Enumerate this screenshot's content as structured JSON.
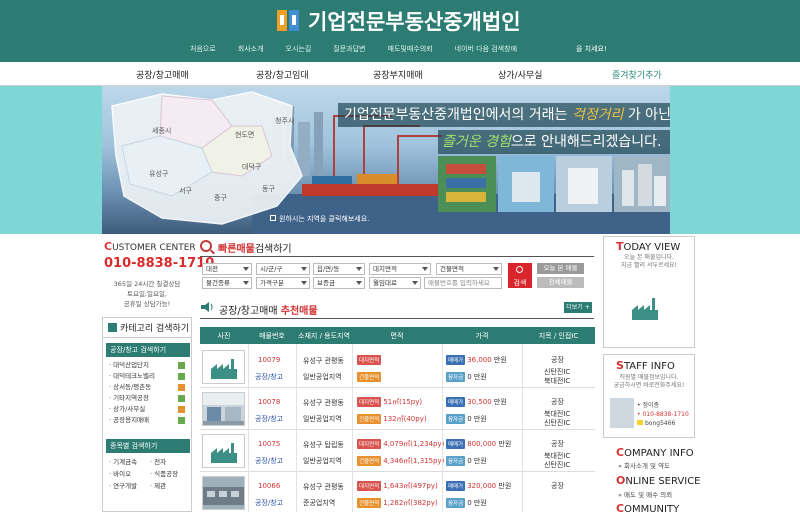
{
  "header": {
    "logo_text": "기업전문부동산중개법인",
    "top_nav": [
      "처음으로",
      "회사소개",
      "오시는길",
      "질문과답변",
      "매도및매수의뢰",
      "네이버 다음 검색창에"
    ],
    "login_text": "을 치세요!",
    "brand_color": "#2c7c73"
  },
  "main_nav": [
    "공장/창고매매",
    "공장/창고임대",
    "공장부지매매",
    "상가/사무실",
    "즐겨찾기추가"
  ],
  "banner": {
    "line1_pre": "기업전문부동산중개법인에서의 거래는 ",
    "line1_hl": "걱정거리",
    "line1_post": " 가 아닌",
    "line2_hl": "즐거운 경험",
    "line2_post": "으로 안내해드리겠습니다.",
    "caption": "원하시는 지역을 클릭해보세요.",
    "regions": [
      "세종시",
      "청주시",
      "현도면",
      "대덕구",
      "유성구",
      "서구",
      "동구",
      "중구"
    ]
  },
  "customer_center": {
    "title_c": "C",
    "title_rest": "USTOMER CENTER",
    "phone": "010-8838-1710",
    "hours": [
      "365일 24시간 칠결상담",
      "토요일,일요일,",
      "공휴일 상담가능!"
    ]
  },
  "category": {
    "title": "카테고리 검색하기",
    "section1": "공장/창고 검색하기",
    "items1": [
      "대덕산업단지",
      "대덕테크노밸리",
      "상서동/평촌동",
      "기타지역공장",
      "상가/사무실",
      "공장용지매매"
    ],
    "section2": "종목별 검색하기",
    "items2": [
      [
        "기계금속",
        "전자"
      ],
      [
        "바이오",
        "식품공장"
      ],
      [
        "연구개발",
        "제관"
      ]
    ]
  },
  "quick_search": {
    "title_red": "빠른매물",
    "title_rest": "검색하기",
    "selects_row1": [
      "대전",
      "시/군/구",
      "읍/면/동",
      "대지면적",
      "건물면적"
    ],
    "selects_row2": [
      "물건종류",
      "가격구분",
      "보증금",
      "월임대료"
    ],
    "input_placeholder": "매물번호를 입력하세요",
    "search_label": "검색",
    "today_btn": "오늘 본 매물",
    "all_btn": "전체매물"
  },
  "recommend": {
    "title_rest": "공장/창고매매 ",
    "title_red": "추천매물",
    "more": "더보기 +"
  },
  "table": {
    "headers": [
      "사진",
      "매물번호",
      "소재지 / 용도지역",
      "면적",
      "가격",
      "지목 / 인접IC"
    ],
    "rows": [
      {
        "code": "10079",
        "type": "공장/창고",
        "loc": "유성구 관평동",
        "zone": "일반공업지역",
        "land": "",
        "bldg": "",
        "tag_land": "대지면적",
        "tag_bldg": "건물면적",
        "price_tag": "매매가",
        "price": "36,000",
        "unit": "만원",
        "loan_tag": "융자금",
        "loan": "0",
        "use": "공장",
        "ic1": "신탄진IC",
        "ic2": "북대전IC",
        "photo": "icon"
      },
      {
        "code": "10078",
        "type": "공장/창고",
        "loc": "유성구 관평동",
        "zone": "일반공업지역",
        "land": "51㎡(15py)",
        "bldg": "132㎡(40py)",
        "tag_land": "대지면적",
        "tag_bldg": "건물면적",
        "price_tag": "매매가",
        "price": "30,500",
        "unit": "만원",
        "loan_tag": "융자금",
        "loan": "0",
        "use": "공장",
        "ic1": "북대전IC",
        "ic2": "신탄진IC",
        "photo": "room"
      },
      {
        "code": "10075",
        "type": "공장/창고",
        "loc": "유성구 탑립동",
        "zone": "일반공업지역",
        "land": "4,079㎡(1,234py)",
        "bldg": "4,346㎡(1,315py)",
        "tag_land": "대지면적",
        "tag_bldg": "건물면적",
        "price_tag": "매매가",
        "price": "800,000",
        "unit": "만원",
        "loan_tag": "융자금",
        "loan": "0",
        "use": "공장",
        "ic1": "북대전IC",
        "ic2": "신탄진IC",
        "photo": "icon"
      },
      {
        "code": "10066",
        "type": "공장/창고",
        "loc": "유성구 관평동",
        "zone": "준공업지역",
        "land": "1,643㎡(497py)",
        "bldg": "1,262㎡(382py)",
        "tag_land": "대지면적",
        "tag_bldg": "건물면적",
        "price_tag": "매매가",
        "price": "320,000",
        "unit": "만원",
        "loan_tag": "융자금",
        "loan": "0",
        "use": "공장",
        "ic1": "",
        "ic2": "",
        "photo": "building"
      }
    ]
  },
  "today_view": {
    "title_c": "T",
    "title_rest": "ODAY VIEW",
    "sub1": "오늘 본 매물입니다.",
    "sub2": "지금 빨리 서두르세요!"
  },
  "staff": {
    "title_c": "S",
    "title_rest": "TAFF INFO",
    "sub1": "직원별 매물정보입니다.",
    "sub2": "궁금하시면 바로전화주세요!",
    "name": "정이종",
    "phone": "010-8838-1710",
    "kakao": "bong5466"
  },
  "company": {
    "title_c": "C",
    "title_rest": "OMPANY INFO",
    "link": "회사소개 및 약도"
  },
  "online": {
    "title_c": "O",
    "title_rest": "NLINE SERVICE",
    "link": "매도 및 매수 의뢰"
  },
  "community": {
    "title_c": "C",
    "title_rest": "OMMUNITY"
  }
}
